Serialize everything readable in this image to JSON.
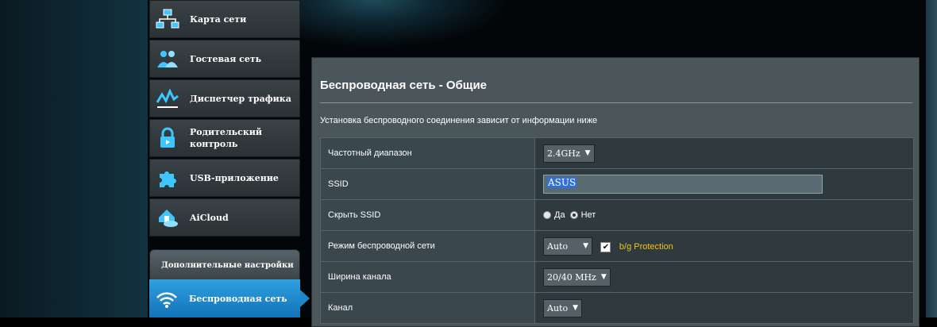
{
  "sidebar": {
    "items": [
      {
        "label": "Карта сети",
        "icon": "network-map-icon"
      },
      {
        "label": "Гостевая сеть",
        "icon": "guest-network-icon"
      },
      {
        "label": "Диспетчер трафика",
        "icon": "traffic-manager-icon"
      },
      {
        "label_line1": "Родительский",
        "label_line2": "контроль",
        "icon": "parental-control-icon"
      },
      {
        "label": "USB-приложение",
        "icon": "usb-puzzle-icon"
      },
      {
        "label": "AiCloud",
        "icon": "aicloud-icon"
      }
    ],
    "section_header": "Дополнительные настройки",
    "active_item": {
      "label": "Беспроводная сеть",
      "icon": "wifi-icon"
    }
  },
  "panel": {
    "title": "Беспроводная сеть - Общие",
    "description": "Установка беспроводного соединения зависит от информации ниже",
    "rows": {
      "band": {
        "label": "Частотный диапазон",
        "value": "2.4GHz"
      },
      "ssid": {
        "label": "SSID",
        "value": "ASUS"
      },
      "hide_ssid": {
        "label": "Скрыть SSID",
        "option_yes": "Да",
        "option_no": "Нет",
        "selected": "Нет"
      },
      "mode": {
        "label": "Режим беспроводной сети",
        "value": "Auto",
        "checkbox_label": "b/g Protection",
        "checked": true
      },
      "width": {
        "label": "Ширина канала",
        "value": "20/40 MHz"
      },
      "channel": {
        "label": "Канал",
        "value": "Auto"
      }
    }
  },
  "colors": {
    "accent": "#1d86c8",
    "warning_label": "#f2c21b",
    "panel_bg": "#4b565b"
  }
}
